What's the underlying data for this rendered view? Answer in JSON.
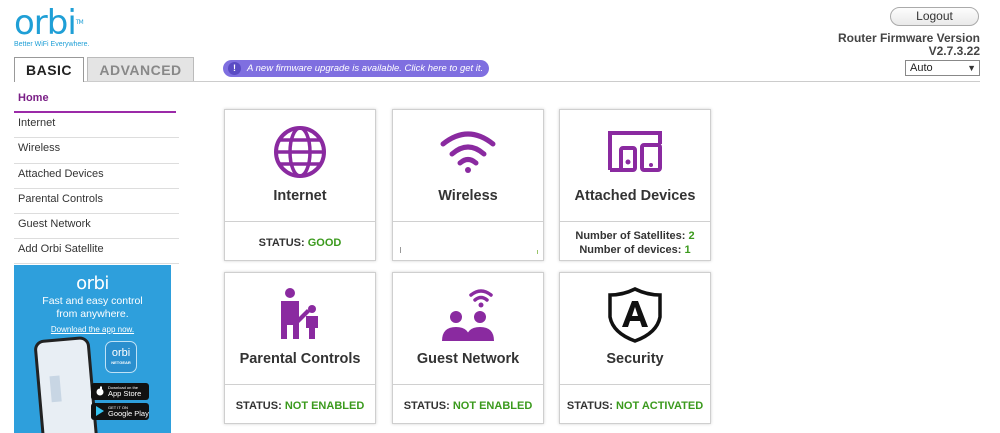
{
  "brand": {
    "logo_text": "orbi",
    "tm": "TM",
    "tagline": "Better WiFi Everywhere."
  },
  "header": {
    "logout_label": "Logout",
    "fw_title": "Router Firmware Version",
    "fw_version": "V2.7.3.22",
    "language_value": "Auto"
  },
  "tabs": [
    {
      "label": "BASIC",
      "active": true
    },
    {
      "label": "ADVANCED",
      "active": false
    }
  ],
  "banner": {
    "icon": "!",
    "text": "A new firmware upgrade is available. Click here to get it."
  },
  "sidebar": {
    "items": [
      {
        "label": "Home",
        "active": true
      },
      {
        "label": "Internet"
      },
      {
        "label": "Wireless"
      },
      {
        "label": "Attached Devices"
      },
      {
        "label": "Parental Controls"
      },
      {
        "label": "Guest Network"
      },
      {
        "label": "Add Orbi Satellite"
      }
    ]
  },
  "promo": {
    "logo": "orbi",
    "line1": "Fast and easy control",
    "line2": "from anywhere.",
    "link": "Download the app now.",
    "app_word": "orbi",
    "app_sub": "NETGEAR",
    "appstore_small": "Download on the",
    "appstore_big": "App Store",
    "gplay_small": "GET IT ON",
    "gplay_big": "Google Play"
  },
  "cards": {
    "internet": {
      "title": "Internet",
      "status_label": "STATUS:",
      "status_value": "GOOD",
      "icon": "globe-icon"
    },
    "wireless": {
      "title": "Wireless",
      "icon": "wifi-icon"
    },
    "attached": {
      "title": "Attached Devices",
      "sat_label": "Number of Satellites:",
      "sat_value": "2",
      "dev_label": "Number of devices:",
      "dev_value": "1",
      "icon": "devices-icon"
    },
    "parental": {
      "title": "Parental Controls",
      "status_label": "STATUS:",
      "status_value": "NOT ENABLED",
      "icon": "parent-child-icon"
    },
    "guest": {
      "title": "Guest Network",
      "status_label": "STATUS:",
      "status_value": "NOT ENABLED",
      "icon": "guest-users-icon"
    },
    "security": {
      "title": "Security",
      "status_label": "STATUS:",
      "status_value": "NOT ACTIVATED",
      "icon": "shield-icon"
    }
  },
  "colors": {
    "brand_blue": "#1f9fd6",
    "purple": "#8a2aa0",
    "status_green": "#3b9a1d",
    "banner": "#7f6fe0"
  }
}
